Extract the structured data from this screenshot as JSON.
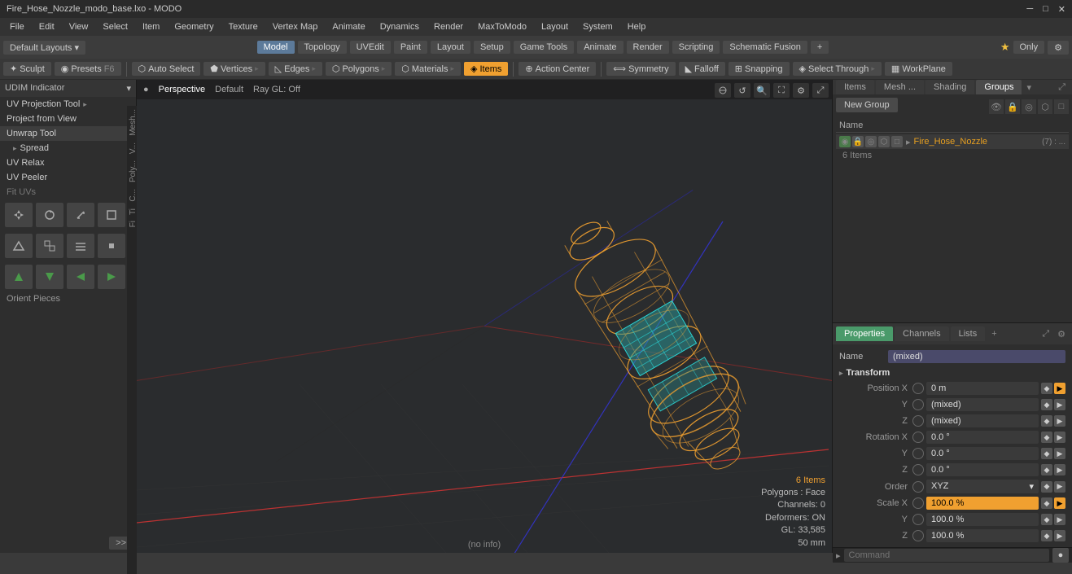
{
  "window": {
    "title": "Fire_Hose_Nozzle_modo_base.lxo - MODO"
  },
  "titlebar": {
    "controls": [
      "─",
      "□",
      "✕"
    ]
  },
  "menubar": {
    "items": [
      "File",
      "Edit",
      "View",
      "Select",
      "Item",
      "Geometry",
      "Texture",
      "Vertex Map",
      "Animate",
      "Dynamics",
      "Render",
      "MaxToModo",
      "Layout",
      "System",
      "Help"
    ]
  },
  "toolbar1": {
    "layout_label": "Default Layouts",
    "layout_arrow": "▾",
    "star_icon": "★",
    "only_label": "Only",
    "settings_icon": "⚙"
  },
  "mode_tabs": {
    "tabs": [
      "Model",
      "Topology",
      "UVEdit",
      "Paint",
      "Layout",
      "Setup",
      "Game Tools",
      "Animate",
      "Render",
      "Scripting",
      "Schematic Fusion"
    ],
    "active": "Topology",
    "add_icon": "+"
  },
  "toolbar3": {
    "sculpt_label": "Sculpt",
    "presets_label": "Presets",
    "presets_key": "F6",
    "select_tools": [
      {
        "label": "Auto Select",
        "icon": "◈",
        "active": false
      },
      {
        "label": "Vertices",
        "icon": "·",
        "active": false
      },
      {
        "label": "Edges",
        "icon": "╱",
        "active": false
      },
      {
        "label": "Polygons",
        "icon": "◻",
        "active": false
      },
      {
        "label": "Materials",
        "icon": "◈",
        "active": false
      },
      {
        "label": "Items",
        "icon": "◈",
        "active": true
      },
      {
        "label": "Action Center",
        "icon": "⊕",
        "active": false
      },
      {
        "label": "Symmetry",
        "icon": "⟺",
        "active": false
      },
      {
        "label": "Falloff",
        "icon": "◣",
        "active": false
      },
      {
        "label": "Snapping",
        "icon": "⊞",
        "active": false
      },
      {
        "label": "Select Through",
        "icon": "◈",
        "active": false
      },
      {
        "label": "WorkPlane",
        "icon": "▦",
        "active": false
      }
    ]
  },
  "left_panel": {
    "header": "UDIM Indicator",
    "tools": [
      {
        "label": "UV Projection Tool",
        "has_arrow": true
      },
      {
        "label": "Project from View",
        "has_arrow": false
      },
      {
        "label": "Unwrap Tool",
        "has_arrow": false
      },
      {
        "label": "Spread",
        "is_sub": true
      },
      {
        "label": "UV Relax",
        "has_arrow": false
      },
      {
        "label": "UV Peeler",
        "has_arrow": false
      },
      {
        "label": "Fit UVs",
        "has_arrow": false
      }
    ],
    "icon_rows_1": [
      "▷",
      "⬡",
      "↕",
      "◼"
    ],
    "icon_rows_2": [
      "⬡",
      "▦",
      "≡",
      "▪"
    ],
    "icon_rows_3": [
      "↑",
      "↓",
      "←",
      "→"
    ],
    "orient_label": "Orient Pieces",
    "expand_btn": ">>"
  },
  "viewport": {
    "mode": "Perspective",
    "shading": "Default",
    "raygl": "Ray GL: Off",
    "stats": {
      "items": "6 Items",
      "polygons": "Polygons : Face",
      "channels": "Channels: 0",
      "deformers": "Deformers: ON",
      "gl": "GL: 33,585",
      "size": "50 mm"
    },
    "no_info": "(no info)"
  },
  "right_panel": {
    "tabs": [
      "Items",
      "Mesh ...",
      "Shading",
      "Groups"
    ],
    "active_tab": "Groups",
    "new_group_btn": "New Group",
    "items_columns": [
      "Name"
    ],
    "items": [
      {
        "name": "Fire_Hose_Nozzle",
        "suffix": "(7) : ...",
        "sub_label": "6 Items",
        "color": "#e8a020"
      }
    ]
  },
  "properties": {
    "tabs": [
      "Properties",
      "Channels",
      "Lists"
    ],
    "active_tab": "Properties",
    "add_icon": "+",
    "name_label": "Name",
    "name_value": "(mixed)",
    "transform_section": "Transform",
    "fields": [
      {
        "label": "Position X",
        "value": "0 m",
        "highlight": false
      },
      {
        "label": "Y",
        "value": "(mixed)",
        "highlight": false
      },
      {
        "label": "Z",
        "value": "(mixed)",
        "highlight": false
      },
      {
        "label": "Rotation X",
        "value": "0.0 °",
        "highlight": false
      },
      {
        "label": "Y",
        "value": "0.0 °",
        "highlight": false
      },
      {
        "label": "Z",
        "value": "0.0 °",
        "highlight": false
      },
      {
        "label": "Order",
        "value": "XYZ",
        "highlight": false,
        "is_select": true
      },
      {
        "label": "Scale X",
        "value": "100.0 %",
        "highlight": true
      },
      {
        "label": "Y",
        "value": "100.0 %",
        "highlight": false
      },
      {
        "label": "Z",
        "value": "100.0 %",
        "highlight": false
      }
    ]
  },
  "command_bar": {
    "placeholder": "Command",
    "exec_icon": "▶"
  },
  "colors": {
    "accent_orange": "#f0a030",
    "accent_green": "#4a9a6a",
    "active_tab_bg": "#5c7a9a",
    "item_name_color": "#e8a020"
  }
}
